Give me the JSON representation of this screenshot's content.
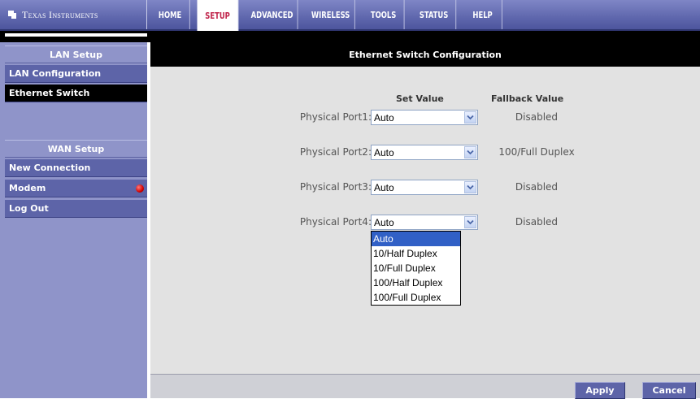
{
  "brand": {
    "text": "Texas Instruments",
    "logo": "ti-logo-icon"
  },
  "nav": {
    "tabs": [
      {
        "label": "HOME"
      },
      {
        "label": "SETUP"
      },
      {
        "label": "ADVANCED"
      },
      {
        "label": "WIRELESS"
      },
      {
        "label": "TOOLS"
      },
      {
        "label": "STATUS"
      },
      {
        "label": "HELP"
      }
    ],
    "active_tab": "SETUP"
  },
  "sidebar": {
    "lan_header": "LAN Setup",
    "lan_items": [
      {
        "label": "LAN Configuration"
      },
      {
        "label": "Ethernet Switch"
      }
    ],
    "wan_header": "WAN Setup",
    "wan_items": [
      {
        "label": "New Connection"
      },
      {
        "label": "Modem",
        "status_icon": "red-status-dot-icon"
      },
      {
        "label": "Log Out"
      }
    ]
  },
  "main": {
    "title": "Ethernet Switch Configuration",
    "set_value_header": "Set Value",
    "fallback_header": "Fallback Value",
    "ports": [
      {
        "label": "Physical Port1:",
        "value": "Auto",
        "fallback": "Disabled"
      },
      {
        "label": "Physical Port2:",
        "value": "Auto",
        "fallback": "100/Full Duplex"
      },
      {
        "label": "Physical Port3:",
        "value": "Auto",
        "fallback": "Disabled"
      },
      {
        "label": "Physical Port4:",
        "value": "Auto",
        "fallback": "Disabled"
      }
    ],
    "dropdown_options": [
      {
        "label": "Auto",
        "selected": true
      },
      {
        "label": "10/Half Duplex"
      },
      {
        "label": "10/Full Duplex"
      },
      {
        "label": "100/Half Duplex"
      },
      {
        "label": "100/Full Duplex"
      }
    ]
  },
  "footer": {
    "apply_label": "Apply",
    "cancel_label": "Cancel"
  },
  "colors": {
    "nav_bg": "#5f67ad",
    "sidebar_bg": "#8f94c9",
    "sidebar_item_bg": "#5d64a8",
    "active_tab_text": "#c0234a",
    "selected_option_bg": "#3160c6"
  }
}
